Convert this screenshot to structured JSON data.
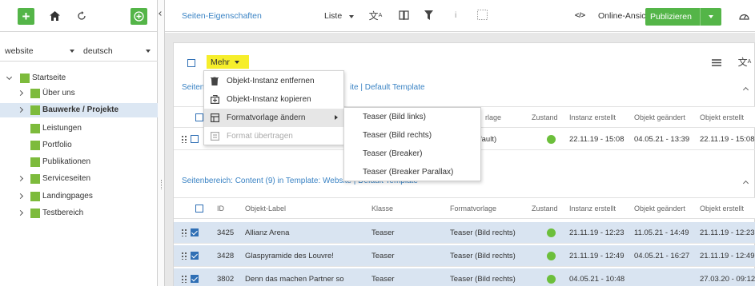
{
  "sidebar": {
    "site_select": "website",
    "lang_select": "deutsch",
    "tree": [
      {
        "label": "Startseite",
        "expanded": true,
        "bold": false
      },
      {
        "label": "Über uns",
        "bold": false
      },
      {
        "label": "Bauwerke / Projekte",
        "bold": true,
        "selected": true
      },
      {
        "label": "Leistungen",
        "bold": false
      },
      {
        "label": "Portfolio",
        "bold": false
      },
      {
        "label": "Publikationen",
        "bold": false
      },
      {
        "label": "Serviceseiten",
        "bold": false
      },
      {
        "label": "Landingpages",
        "bold": false
      },
      {
        "label": "Testbereich",
        "bold": false
      }
    ]
  },
  "topbar": {
    "page_properties": "Seiten-Eigenschaften",
    "view_mode": "Liste",
    "online_view": "Online-Ansicht",
    "publish": "Publizieren",
    "code_icon_text": "</>"
  },
  "toolbar": {
    "more_label": "Mehr"
  },
  "section1": {
    "title_prefix": "Seiten",
    "title_suffix": "ite | Default Template",
    "headers": {
      "formatvorlage": "rlage",
      "zustand": "Zustand",
      "instanz": "Instanz erstellt",
      "geaendert": "Objekt geändert",
      "erstellt": "Objekt erstellt"
    },
    "row": {
      "format": "fault)",
      "instanz": "22.11.19 - 15:08",
      "geaendert": "04.05.21 - 13:39",
      "erstellt": "22.11.19 - 15:08"
    }
  },
  "section2": {
    "title": "Seitenbereich: Content (9) in Template: Website | Default Template",
    "headers": {
      "id": "ID",
      "label": "Objekt-Label",
      "klasse": "Klasse",
      "formatvorlage": "Formatvorlage",
      "zustand": "Zustand",
      "instanz": "Instanz erstellt",
      "geaendert": "Objekt geändert",
      "erstellt": "Objekt erstellt"
    },
    "rows": [
      {
        "id": "3425",
        "label": "Allianz Arena",
        "klasse": "Teaser",
        "format": "Teaser (Bild rechts)",
        "instanz": "21.11.19 - 12:23",
        "geaendert": "11.05.21 - 14:49",
        "erstellt": "21.11.19 - 12:23"
      },
      {
        "id": "3428",
        "label": "Glaspyramide des Louvre!",
        "klasse": "Teaser",
        "format": "Teaser (Bild rechts)",
        "instanz": "21.11.19 - 12:49",
        "geaendert": "04.05.21 - 16:27",
        "erstellt": "21.11.19 - 12:49"
      },
      {
        "id": "3802",
        "label": "Denn das machen Partner so",
        "klasse": "Teaser",
        "format": "Teaser (Bild rechts)",
        "instanz": "04.05.21 - 10:48",
        "geaendert": "",
        "erstellt": "27.03.20 - 09:12"
      }
    ]
  },
  "menu": {
    "items": [
      {
        "label": "Objekt-Instanz entfernen",
        "icon": "trash-icon"
      },
      {
        "label": "Objekt-Instanz kopieren",
        "icon": "copy-icon"
      },
      {
        "label": "Formatvorlage ändern",
        "icon": "template-icon"
      },
      {
        "label": "Format übertragen",
        "icon": "format-transfer-icon"
      }
    ],
    "submenu": [
      "Teaser (Bild links)",
      "Teaser (Bild rechts)",
      "Teaser (Breaker)",
      "Teaser (Breaker Parallax)"
    ]
  },
  "colors": {
    "accent_green": "#54b548",
    "folder_green": "#7dbb3c",
    "link_blue": "#3a83c4",
    "highlight_yellow": "#f6ee2b",
    "selected_row": "#d9e4f1"
  }
}
